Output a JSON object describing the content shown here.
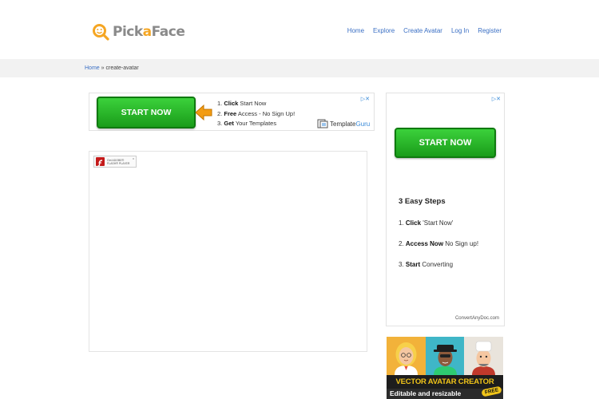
{
  "header": {
    "logo_text_a": "Pick",
    "logo_text_b": "a",
    "logo_text_c": "Face",
    "nav": [
      "Home",
      "Explore",
      "Create Avatar",
      "Log In",
      "Register"
    ]
  },
  "breadcrumb": {
    "home": "Home",
    "separator": " » ",
    "current": "create-avatar"
  },
  "ad_top": {
    "button_label": "START NOW",
    "steps": [
      {
        "num": "1.",
        "bold": "Click",
        "rest": " Start Now"
      },
      {
        "num": "2.",
        "bold": "Free",
        "rest": " Access - No Sign Up!"
      },
      {
        "num": "3.",
        "bold": "Get",
        "rest": " Your Templates"
      }
    ],
    "brand_a": "Template",
    "brand_b": "Guru",
    "adchoice": "▷✕"
  },
  "flash": {
    "badge_line1": "Get ADOBE®",
    "badge_line2": "FLASH® PLAYER",
    "close": "x"
  },
  "ad_right": {
    "adchoice": "▷✕",
    "button_label": "START NOW",
    "title": "3 Easy Steps",
    "steps": [
      {
        "num": "1.",
        "bold": "Click",
        "rest": " 'Start Now'"
      },
      {
        "num": "2.",
        "bold": "Access Now",
        "rest": " No Sign up!"
      },
      {
        "num": "3.",
        "bold": "Start",
        "rest": " Converting"
      }
    ],
    "url": "ConvertAnyDoc.com"
  },
  "avatar_banner": {
    "title": "VECTOR AVATAR CREATOR",
    "subtitle": "Editable and resizable",
    "badge": "FREE"
  },
  "colors": {
    "link": "#3a6fc4",
    "accent": "#f5a623",
    "cta_green": "#1a9c1a",
    "banner_yellow": "#f0c419"
  }
}
